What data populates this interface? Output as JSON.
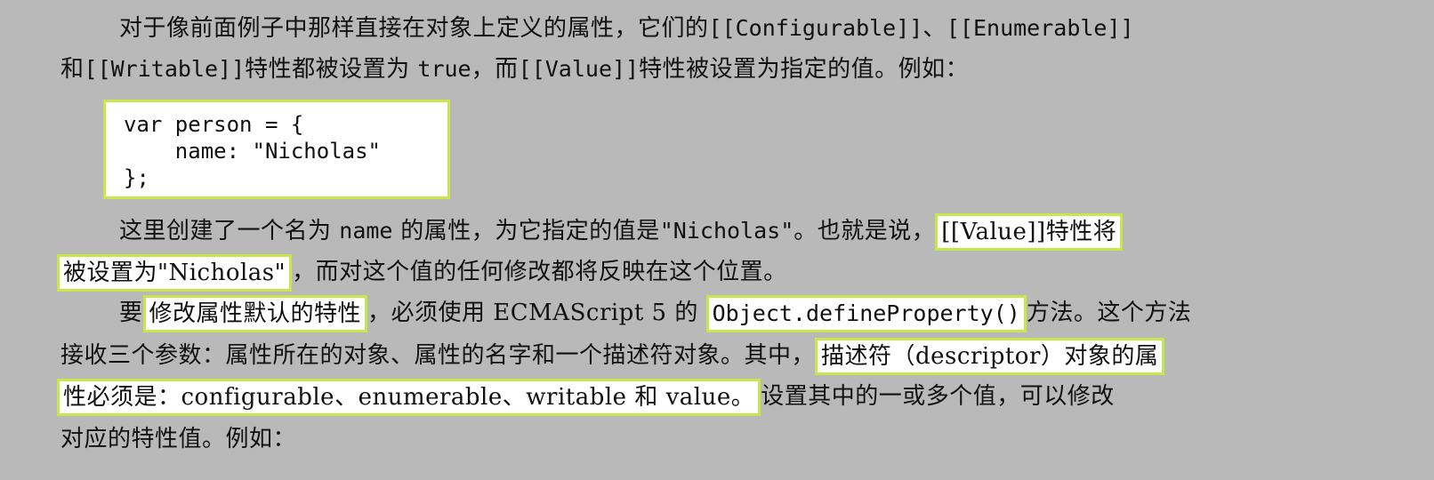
{
  "lines": [
    {
      "segments": [
        "对于像前面例子中那样直接在对象上定义的属性，它们的",
        "[[Configurable]]",
        "、",
        "[[Enumerable]]"
      ]
    },
    {
      "segments": [
        "和",
        "[[Writable]]",
        "特性都被设置为 ",
        "true",
        "，而",
        "[[Value]]",
        "特性被设置为指定的值。例如："
      ]
    },
    {
      "segments": [
        "这里创建了一个名为 ",
        "name",
        " 的属性，为它指定的值是",
        "\"Nicholas\"",
        "。也就是说，",
        "[[Value]]特性将"
      ]
    },
    {
      "segments": [
        "被设置为\"Nicholas\"",
        "，而对这个值的任何修改都将反映在这个位置。"
      ]
    },
    {
      "segments": [
        "要",
        "修改属性默认的特性",
        "，必须使用 ECMAScript 5 的 ",
        "Object.defineProperty()",
        "方法。这个方法"
      ]
    },
    {
      "segments": [
        "接收三个参数：属性所在的对象、属性的名字和一个描述符对象。其中，",
        "描述符（descriptor）对象的属"
      ]
    },
    {
      "segments": [
        "性必须是：configurable、enumerable、writable 和 value。",
        "设置其中的一或多个值，可以修改"
      ]
    },
    {
      "segments": [
        "对应的特性值。例如："
      ]
    }
  ],
  "code": [
    "var person = {",
    "    name: \"Nicholas\"",
    "};"
  ],
  "colors": {
    "background": "#b9b9b9",
    "highlight_border": "#c6e84c",
    "highlight_fill": "#ffffff"
  }
}
